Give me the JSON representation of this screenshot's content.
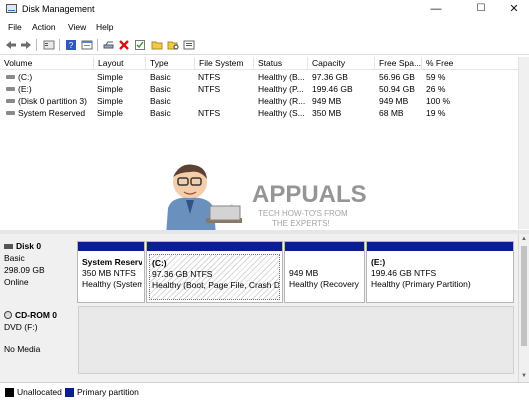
{
  "window": {
    "title": "Disk Management",
    "minimize": "—",
    "maximize": "☐",
    "close": "✕"
  },
  "menu": [
    "File",
    "Action",
    "View",
    "Help"
  ],
  "toolbar": {
    "icons": [
      "back-arrow",
      "forward-arrow",
      "up-level",
      "help-book",
      "properties-sheet",
      "connect-key",
      "delete-x",
      "check-box",
      "folder-open",
      "folder-search",
      "list-view"
    ]
  },
  "table": {
    "columns": [
      "Volume",
      "Layout",
      "Type",
      "File System",
      "Status",
      "Capacity",
      "Free Spa...",
      "% Free"
    ],
    "rows": [
      [
        "(C:)",
        "Simple",
        "Basic",
        "NTFS",
        "Healthy (B...",
        "97.36 GB",
        "56.96 GB",
        "59 %"
      ],
      [
        "(E:)",
        "Simple",
        "Basic",
        "NTFS",
        "Healthy (P...",
        "199.46 GB",
        "50.94 GB",
        "26 %"
      ],
      [
        "(Disk 0 partition 3)",
        "Simple",
        "Basic",
        "",
        "Healthy (R...",
        "949 MB",
        "949 MB",
        "100 %"
      ],
      [
        "System Reserved",
        "Simple",
        "Basic",
        "NTFS",
        "Healthy (S...",
        "350 MB",
        "68 MB",
        "19 %"
      ]
    ]
  },
  "watermark": {
    "brand": "APPUALS",
    "tagline": "TECH HOW-TO'S FROM",
    "tagline2": "THE EXPERTS!"
  },
  "disks": [
    {
      "name": "Disk 0",
      "type": "Basic",
      "size": "298.09 GB",
      "status": "Online",
      "partitions": [
        {
          "name": "System Reserv",
          "detail": "350 MB NTFS",
          "status": "Healthy (System",
          "selected": false
        },
        {
          "name": "(C:)",
          "detail": "97.36 GB NTFS",
          "status": "Healthy (Boot, Page File, Crash Du",
          "selected": true
        },
        {
          "name": "",
          "detail": "949 MB",
          "status": "Healthy (Recovery I",
          "selected": false
        },
        {
          "name": "(E:)",
          "detail": "199.46 GB NTFS",
          "status": "Healthy (Primary Partition)",
          "selected": false
        }
      ]
    },
    {
      "name": "CD-ROM 0",
      "type": "DVD (F:)",
      "size": "",
      "status": "No Media",
      "partitions": []
    }
  ],
  "legend": [
    {
      "label": "Unallocated",
      "color": "#000000"
    },
    {
      "label": "Primary partition",
      "color": "#0a1f8c"
    }
  ]
}
